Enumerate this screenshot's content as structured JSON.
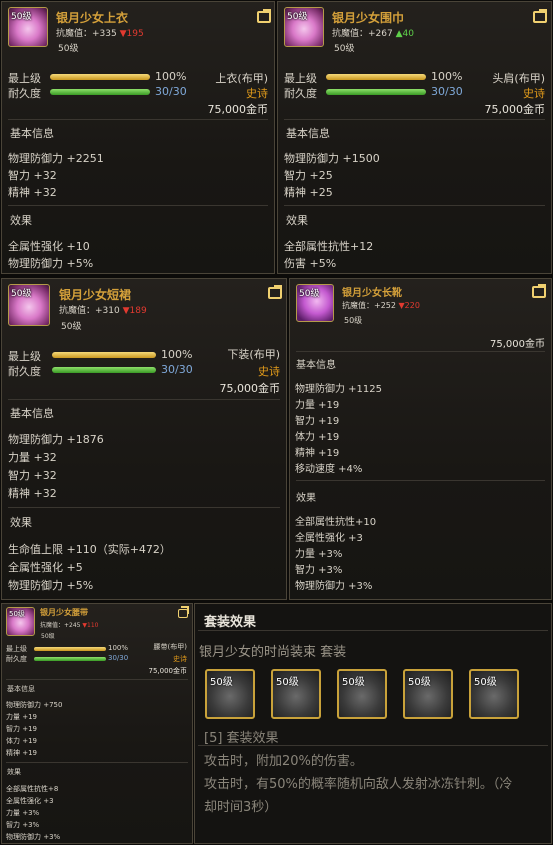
{
  "items": [
    {
      "level_badge": "50级",
      "name": "银月少女上衣",
      "resist_label": "抗魔值：",
      "resist_value": "+335",
      "resist_diff": "▼195",
      "resist_diff_dir": "down",
      "level": "50级",
      "max_level_label": "最上级",
      "max_level_pct": "100%",
      "max_level_fraction": 1.0,
      "durability_label": "耐久度",
      "durability": "30/30",
      "durability_fraction": 1.0,
      "type": "上衣(布甲)",
      "rarity": "史诗",
      "price": "75,000金币",
      "basic_title": "基本信息",
      "basic": [
        "物理防御力 +2251",
        "智力 +32",
        "精神 +32"
      ],
      "effect_title": "效果",
      "effects": [
        "全属性强化 +10",
        "物理防御力 +5%"
      ]
    },
    {
      "level_badge": "50级",
      "name": "银月少女围巾",
      "resist_label": "抗魔值：",
      "resist_value": "+267",
      "resist_diff": "▲40",
      "resist_diff_dir": "up",
      "level": "50级",
      "max_level_label": "最上级",
      "max_level_pct": "100%",
      "max_level_fraction": 1.0,
      "durability_label": "耐久度",
      "durability": "30/30",
      "durability_fraction": 1.0,
      "type": "头肩(布甲)",
      "rarity": "史诗",
      "price": "75,000金币",
      "basic_title": "基本信息",
      "basic": [
        "物理防御力 +1500",
        "智力 +25",
        "精神 +25"
      ],
      "effect_title": "效果",
      "effects": [
        "全部属性抗性+12",
        "伤害 +5%"
      ]
    },
    {
      "level_badge": "50级",
      "name": "银月少女短裙",
      "resist_label": "抗魔值：",
      "resist_value": "+310",
      "resist_diff": "▼189",
      "resist_diff_dir": "down",
      "level": "50级",
      "max_level_label": "最上级",
      "max_level_pct": "100%",
      "max_level_fraction": 1.0,
      "durability_label": "耐久度",
      "durability": "30/30",
      "durability_fraction": 1.0,
      "type": "下装(布甲)",
      "rarity": "史诗",
      "price": "75,000金币",
      "basic_title": "基本信息",
      "basic": [
        "物理防御力 +1876",
        "力量 +32",
        "智力 +32",
        "精神 +32"
      ],
      "effect_title": "效果",
      "effects": [
        "生命值上限 +110（实际+472）",
        "全属性强化 +5",
        "物理防御力 +5%"
      ]
    },
    {
      "level_badge": "50级",
      "name": "银月少女长靴",
      "resist_label": "抗魔值：",
      "resist_value": "+252",
      "resist_diff": "▼220",
      "resist_diff_dir": "down",
      "level": "50级",
      "price": "75,000金币",
      "basic_title": "基本信息",
      "basic": [
        "物理防御力 +1125",
        "力量 +19",
        "智力 +19",
        "体力 +19",
        "精神 +19",
        "移动速度 +4%"
      ],
      "effect_title": "效果",
      "effects": [
        "全部属性抗性+10",
        "全属性强化 +3",
        "力量 +3%",
        "智力 +3%",
        "物理防御力 +3%"
      ]
    },
    {
      "level_badge": "50级",
      "name": "银月少女腰带",
      "resist_label": "抗魔值：",
      "resist_value": "+245",
      "resist_diff": "▼110",
      "resist_diff_dir": "down",
      "level": "50级",
      "max_level_label": "最上级",
      "max_level_pct": "100%",
      "max_level_fraction": 1.0,
      "durability_label": "耐久度",
      "durability": "30/30",
      "durability_fraction": 1.0,
      "type": "腰带(布甲)",
      "rarity": "史诗",
      "price": "75,000金币",
      "basic_title": "基本信息",
      "basic": [
        "物理防御力 +750",
        "力量 +19",
        "智力 +19",
        "体力 +19",
        "精神 +19"
      ],
      "effect_title": "效果",
      "effects": [
        "全部属性抗性+8",
        "全属性强化 +3",
        "力量 +3%",
        "智力 +3%",
        "物理防御力 +3%"
      ]
    }
  ],
  "set": {
    "title": "套装效果",
    "name": "银月少女的时尚装束 套装",
    "slots": [
      "50级",
      "50级",
      "50级",
      "50级",
      "50级"
    ],
    "bonus_header": "[5] 套装效果",
    "bonus_lines": [
      "攻击时，附加20%的伤害。",
      "攻击时，有50%的概率随机向敌人发射冰冻针刺。（冷",
      "却时间3秒）"
    ]
  },
  "colors": {
    "name": "#d4a03a",
    "rarity_epic": "#e09a1a",
    "up": "#5fd04a",
    "down": "#e23a30"
  }
}
